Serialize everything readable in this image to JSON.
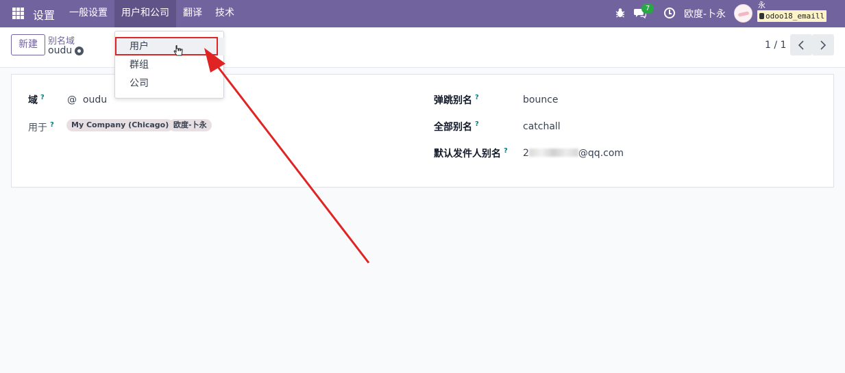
{
  "navbar": {
    "brand": "设置",
    "menu": [
      "一般设置",
      "用户和公司",
      "翻译",
      "技术"
    ],
    "message_count": "7",
    "company": "欧度-卜永",
    "user_initial": "永",
    "database": "odoo18_emaill"
  },
  "control_panel": {
    "new_button": "新建",
    "breadcrumb_parent": "别名域",
    "record_name": "oudu",
    "pager": "1 / 1"
  },
  "dropdown": {
    "items": [
      "用户",
      "群组",
      "公司"
    ]
  },
  "form": {
    "domain_label": "域",
    "domain_prefix": "@",
    "domain_value": "oudu",
    "used_for_label": "用于",
    "used_for_tags": [
      "My Company (Chicago)",
      "欧度-卜永"
    ],
    "bounce_label": "弹跳别名",
    "bounce_value": "bounce",
    "catchall_label": "全部别名",
    "catchall_value": "catchall",
    "default_from_label": "默认发件人别名",
    "default_from_prefix": "2",
    "default_from_suffix": "@qq.com"
  },
  "colors": {
    "navbar": "#71639e",
    "accent": "#71639e",
    "annotation": "#dc2626"
  }
}
